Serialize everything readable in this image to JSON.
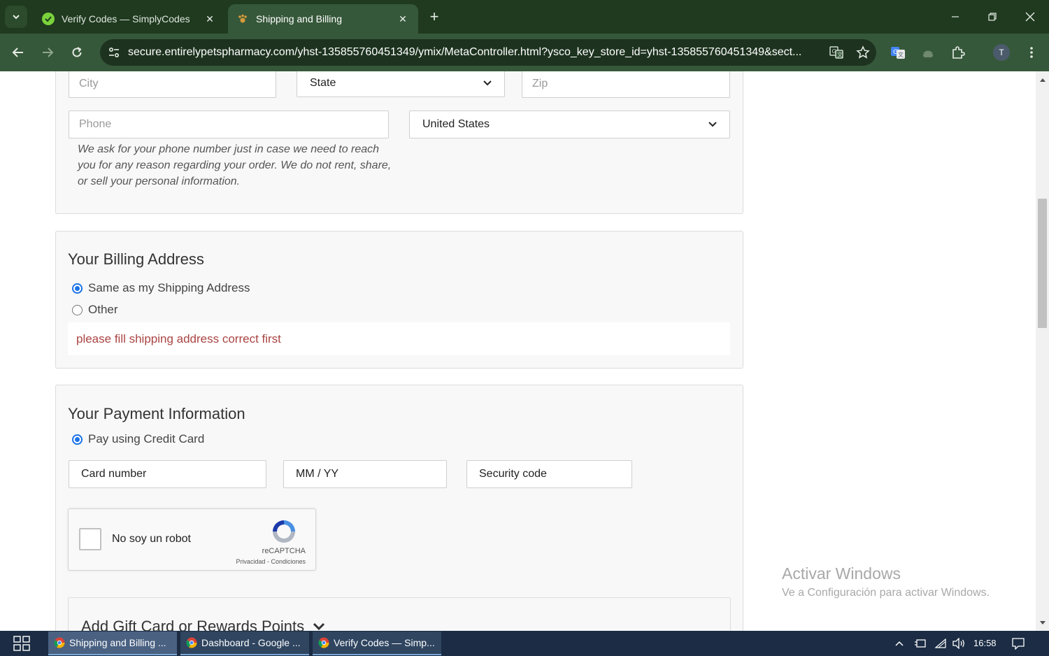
{
  "browser": {
    "tabs": [
      {
        "title": "Verify Codes — SimplyCodes",
        "active": false
      },
      {
        "title": "Shipping and Billing",
        "active": true
      }
    ],
    "url": "secure.entirelypetspharmacy.com/yhst-135855760451349/ymix/MetaController.html?ysco_key_store_id=yhst-135855760451349&sect...",
    "profile_initial": "T",
    "colors": {
      "frame": "#1f3a1f",
      "toolbar": "#36583a",
      "omnibox": "#1d331f"
    }
  },
  "shipping": {
    "city_placeholder": "City",
    "state_label": "State",
    "zip_placeholder": "Zip",
    "phone_placeholder": "Phone",
    "country_value": "United States",
    "phone_note": "We ask for your phone number just in case we need to reach you for any reason regarding your order. We do not rent, share, or sell your personal information."
  },
  "billing": {
    "title": "Your Billing Address",
    "option_same": "Same as my Shipping Address",
    "option_other": "Other",
    "selected": "same",
    "error_message": "please fill shipping address correct first",
    "error_color": "#a94442"
  },
  "payment": {
    "title": "Your Payment Information",
    "option_credit_card": "Pay using Credit Card",
    "card_number_placeholder": "Card number",
    "expiry_placeholder": "MM / YY",
    "security_code_placeholder": "Security code"
  },
  "recaptcha": {
    "label": "No soy un robot",
    "brand": "reCAPTCHA",
    "links": "Privacidad - Condiciones"
  },
  "gift": {
    "title": "Add Gift Card or Rewards Points"
  },
  "watermark": {
    "line1": "Activar Windows",
    "line2": "Ve a Configuración para activar Windows."
  },
  "taskbar": {
    "items": [
      {
        "label": "Shipping and Billing ...",
        "active": true
      },
      {
        "label": "Dashboard - Google ...",
        "active": false
      },
      {
        "label": "Verify Codes — Simp...",
        "active": false
      }
    ],
    "clock": "16:58"
  }
}
